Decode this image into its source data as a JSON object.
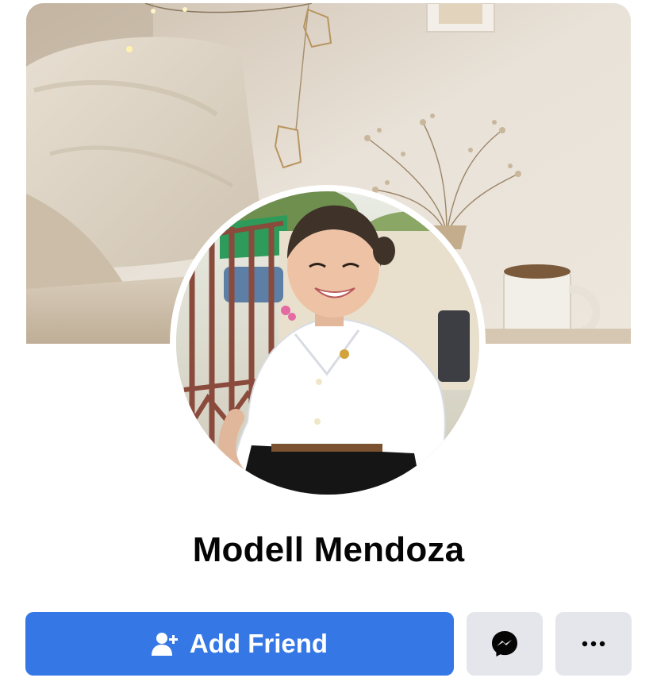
{
  "profile": {
    "name": "Modell Mendoza"
  },
  "actions": {
    "add_friend_label": "Add Friend",
    "add_friend_icon": "add-friend-icon",
    "messenger_icon": "messenger-icon",
    "more_icon": "more-options-icon"
  },
  "colors": {
    "primary_button": "#3578e5",
    "secondary_button": "#e4e6eb",
    "name_text": "#050505"
  }
}
